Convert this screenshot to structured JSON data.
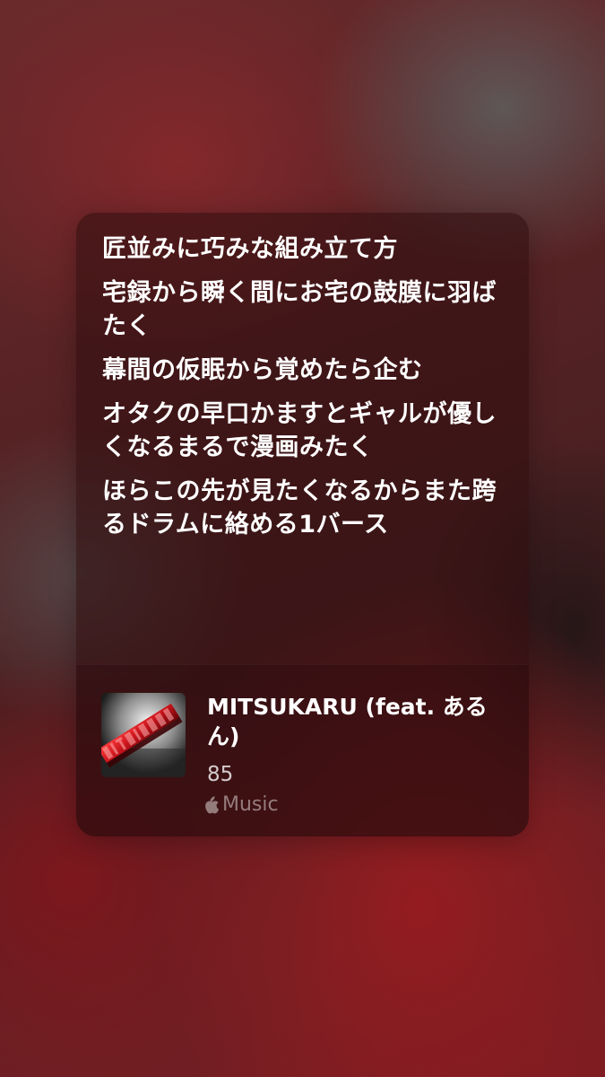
{
  "lyrics": [
    "匠並みに巧みな組み立て方",
    "宅録から瞬く間にお宅の鼓膜に羽ばたく",
    "幕間の仮眠から覚めたら企む",
    "オタクの早口かますとギャルが優しくなるまるで漫画みたく",
    "ほらこの先が見たくなるからまた跨るドラムに絡める1バース"
  ],
  "song": {
    "title": "MITSUKARU (feat. あるん)",
    "artist": "85",
    "source_label": "Music",
    "source_icon": "apple-logo-icon",
    "artwork_icon": "album-artwork"
  },
  "colors": {
    "text_primary": "#ffffff",
    "text_secondary": "rgba(255,255,255,0.78)",
    "text_tertiary": "rgba(255,255,255,0.45)",
    "accent_red": "#c8141c"
  }
}
